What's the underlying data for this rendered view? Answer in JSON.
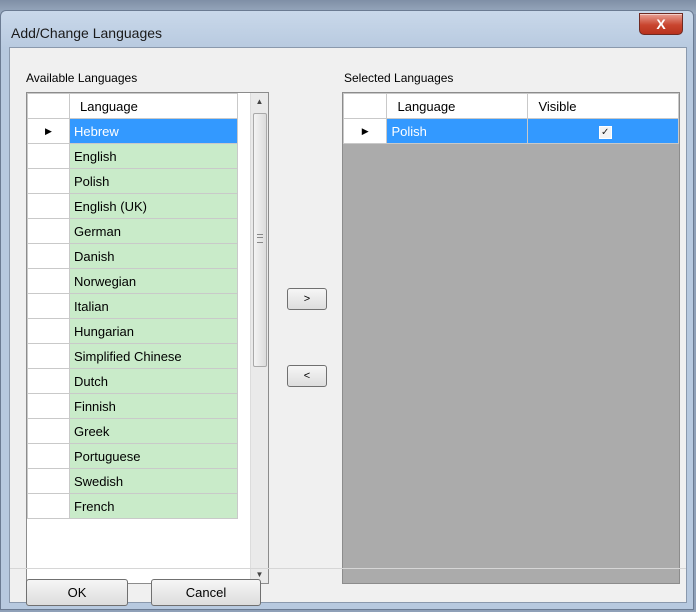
{
  "window": {
    "title": "Add/Change Languages",
    "close_glyph": "X"
  },
  "available": {
    "label": "Available Languages",
    "column": "Language",
    "selected_index": 0,
    "items": [
      "Hebrew",
      "English",
      "Polish",
      "English (UK)",
      "German",
      "Danish",
      "Norwegian",
      "Italian",
      "Hungarian",
      "Simplified Chinese",
      "Dutch",
      "Finnish",
      "Greek",
      "Portuguese",
      "Swedish",
      "French"
    ]
  },
  "selected": {
    "label": "Selected Languages",
    "columns": [
      "Language",
      "Visible"
    ],
    "rows": [
      {
        "language": "Polish",
        "visible": true
      }
    ]
  },
  "buttons": {
    "add": ">",
    "remove": "<",
    "ok": "OK",
    "cancel": "Cancel"
  },
  "colors": {
    "selection": "#3399ff",
    "available_cell": "#c9ebc9",
    "empty_grid": "#ababab"
  }
}
